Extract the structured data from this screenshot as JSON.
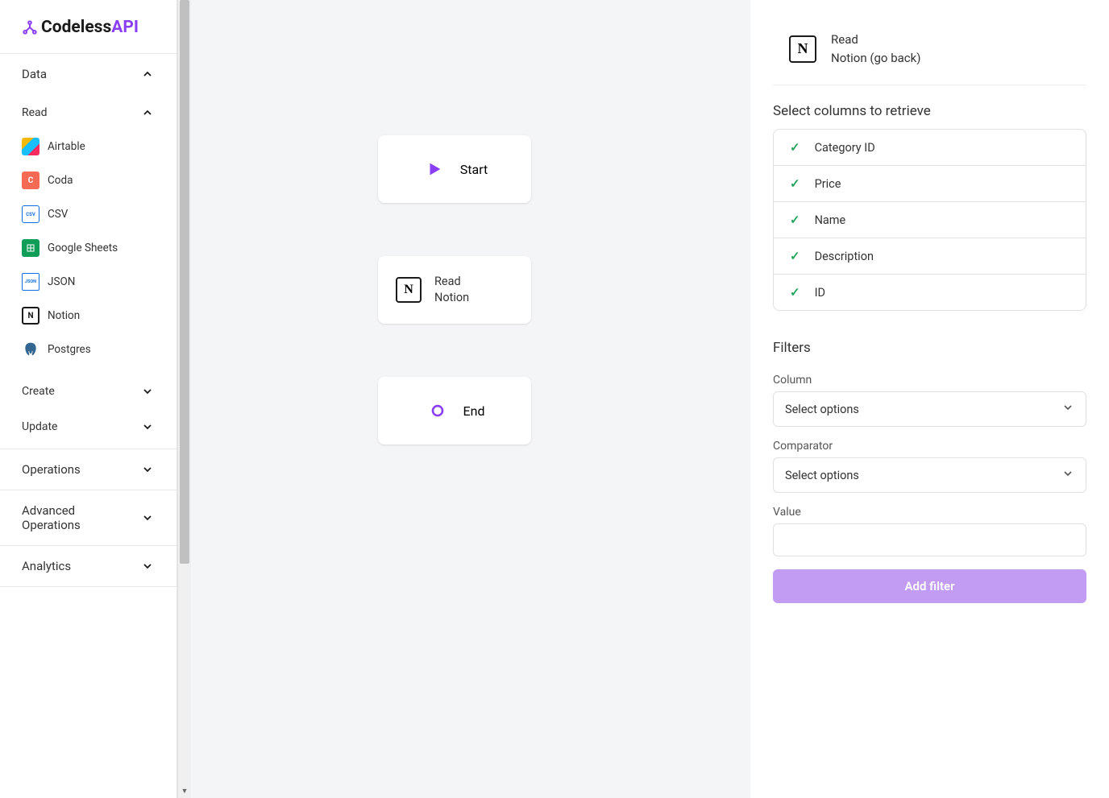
{
  "logo": {
    "text1": "Codeless",
    "text2": "API"
  },
  "sidebar": {
    "data": "Data",
    "read": "Read",
    "sources": [
      {
        "name": "Airtable",
        "icon": "airtable"
      },
      {
        "name": "Coda",
        "icon": "coda",
        "glyph": "C"
      },
      {
        "name": "CSV",
        "icon": "csv",
        "glyph": "CSV"
      },
      {
        "name": "Google Sheets",
        "icon": "sheets"
      },
      {
        "name": "JSON",
        "icon": "json",
        "glyph": "JSON"
      },
      {
        "name": "Notion",
        "icon": "notion",
        "glyph": "N"
      },
      {
        "name": "Postgres",
        "icon": "postgres"
      }
    ],
    "create": "Create",
    "update": "Update",
    "operations": "Operations",
    "advanced": "Advanced Operations",
    "analytics": "Analytics"
  },
  "nodes": {
    "start": "Start",
    "read": {
      "line1": "Read",
      "line2": "Notion"
    },
    "end": "End"
  },
  "panel": {
    "header": {
      "line1": "Read",
      "line2": "Notion (go back)"
    },
    "columnsTitle": "Select columns to retrieve",
    "columns": [
      "Category ID",
      "Price",
      "Name",
      "Description",
      "ID"
    ],
    "filtersTitle": "Filters",
    "columnLabel": "Column",
    "columnPlaceholder": "Select options",
    "comparatorLabel": "Comparator",
    "comparatorPlaceholder": "Select options",
    "valueLabel": "Value",
    "addFilter": "Add filter"
  }
}
